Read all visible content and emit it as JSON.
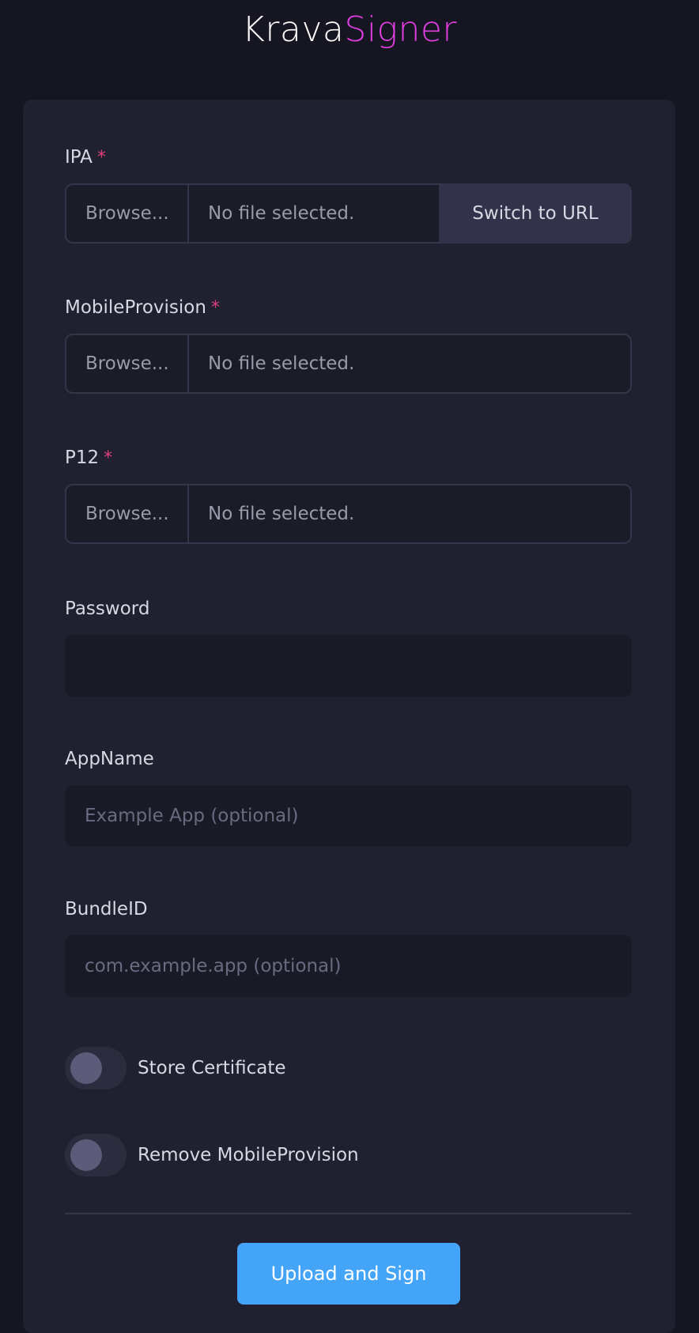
{
  "header": {
    "logo_part1": "Krava",
    "logo_part2": "Signer"
  },
  "form": {
    "ipa": {
      "label": "IPA",
      "required_mark": "*",
      "browse_label": "Browse...",
      "file_status": "No file selected.",
      "switch_label": "Switch to URL"
    },
    "mobileprovision": {
      "label": "MobileProvision",
      "required_mark": "*",
      "browse_label": "Browse...",
      "file_status": "No file selected."
    },
    "p12": {
      "label": "P12",
      "required_mark": "*",
      "browse_label": "Browse...",
      "file_status": "No file selected."
    },
    "password": {
      "label": "Password",
      "value": ""
    },
    "appname": {
      "label": "AppName",
      "placeholder": "Example App (optional)"
    },
    "bundleid": {
      "label": "BundleID",
      "placeholder": "com.example.app (optional)"
    },
    "store_certificate": {
      "label": "Store Certificate",
      "checked": false
    },
    "remove_mobileprovision": {
      "label": "Remove MobileProvision",
      "checked": false
    },
    "submit_label": "Upload and Sign"
  },
  "colors": {
    "background": "#161622",
    "card": "#202030",
    "accent": "#44a4f8",
    "logo_highlight": "#e03fe0",
    "required": "#e0407a"
  }
}
